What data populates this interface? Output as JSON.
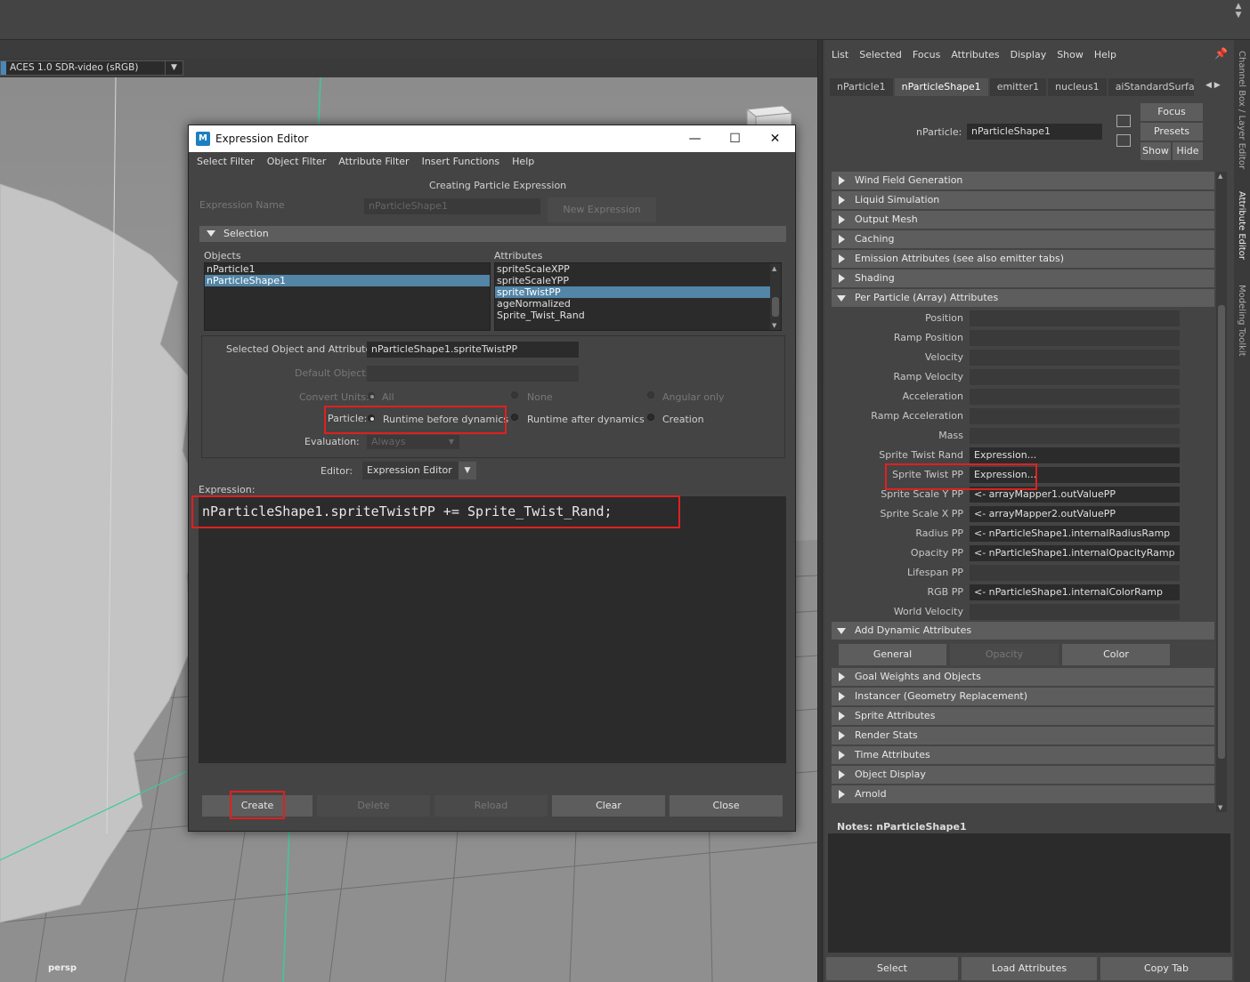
{
  "viewport": {
    "color_space": "ACES 1.0 SDR-video (sRGB)",
    "camera_label": "persp"
  },
  "expression_editor": {
    "title": "Expression Editor",
    "menu": [
      "Select Filter",
      "Object Filter",
      "Attribute Filter",
      "Insert Functions",
      "Help"
    ],
    "subtitle": "Creating Particle Expression",
    "expression_name_label": "Expression Name",
    "expression_name_value": "nParticleShape1",
    "new_expression_button": "New Expression",
    "selection_header": "Selection",
    "objects_label": "Objects",
    "attributes_label": "Attributes",
    "objects": [
      "nParticle1",
      "nParticleShape1"
    ],
    "attributes": [
      "spriteScaleXPP",
      "spriteScaleYPP",
      "spriteTwistPP",
      "ageNormalized",
      "Sprite_Twist_Rand"
    ],
    "selected_label": "Selected Object and Attribute:",
    "selected_value": "nParticleShape1.spriteTwistPP",
    "default_object_label": "Default Object:",
    "convert_units_label": "Convert Units:",
    "convert_units_options": [
      "All",
      "None",
      "Angular only"
    ],
    "particle_label": "Particle:",
    "particle_options": [
      "Runtime before dynamics",
      "Runtime after dynamics",
      "Creation"
    ],
    "evaluation_label": "Evaluation:",
    "evaluation_value": "Always",
    "editor_label": "Editor:",
    "editor_value": "Expression Editor",
    "expression_label": "Expression:",
    "expression_code": "nParticleShape1.spriteTwistPP += Sprite_Twist_Rand;",
    "buttons": {
      "create": "Create",
      "delete": "Delete",
      "reload": "Reload",
      "clear": "Clear",
      "close": "Close"
    }
  },
  "attribute_editor": {
    "menu": [
      "List",
      "Selected",
      "Focus",
      "Attributes",
      "Display",
      "Show",
      "Help"
    ],
    "tabs": [
      "nParticle1",
      "nParticleShape1",
      "emitter1",
      "nucleus1",
      "aiStandardSurface"
    ],
    "node_label": "nParticle:",
    "node_value": "nParticleShape1",
    "focus_button": "Focus",
    "presets_button": "Presets",
    "show_button": "Show",
    "hide_button": "Hide",
    "sections_top": [
      "Wind Field Generation",
      "Liquid Simulation",
      "Output Mesh",
      "Caching",
      "Emission Attributes (see also emitter tabs)",
      "Shading"
    ],
    "per_particle_header": "Per Particle (Array) Attributes",
    "per_particle_rows": [
      {
        "label": "Position",
        "value": ""
      },
      {
        "label": "Ramp Position",
        "value": ""
      },
      {
        "label": "Velocity",
        "value": ""
      },
      {
        "label": "Ramp Velocity",
        "value": ""
      },
      {
        "label": "Acceleration",
        "value": ""
      },
      {
        "label": "Ramp Acceleration",
        "value": ""
      },
      {
        "label": "Mass",
        "value": ""
      },
      {
        "label": "Sprite Twist Rand",
        "value": "Expression..."
      },
      {
        "label": "Sprite Twist PP",
        "value": "Expression..."
      },
      {
        "label": "Sprite Scale Y PP",
        "value": "<- arrayMapper1.outValuePP"
      },
      {
        "label": "Sprite Scale X PP",
        "value": "<- arrayMapper2.outValuePP"
      },
      {
        "label": "Radius PP",
        "value": "<- nParticleShape1.internalRadiusRamp"
      },
      {
        "label": "Opacity PP",
        "value": "<- nParticleShape1.internalOpacityRamp"
      },
      {
        "label": "Lifespan PP",
        "value": ""
      },
      {
        "label": "RGB PP",
        "value": "<- nParticleShape1.internalColorRamp"
      },
      {
        "label": "World Velocity",
        "value": ""
      }
    ],
    "add_dynamic_header": "Add Dynamic Attributes",
    "dynamic_buttons": [
      "General",
      "Opacity",
      "Color"
    ],
    "sections_bottom": [
      "Goal Weights and Objects",
      "Instancer (Geometry Replacement)",
      "Sprite Attributes",
      "Render Stats",
      "Time Attributes",
      "Object Display",
      "Arnold"
    ],
    "notes_label": "Notes:  nParticleShape1",
    "bottom_buttons": [
      "Select",
      "Load Attributes",
      "Copy Tab"
    ]
  },
  "side_tabs": [
    "Channel Box / Layer Editor",
    "Attribute Editor",
    "Modeling Toolkit"
  ],
  "colors": {
    "highlight": "#e02020",
    "selection": "#5285a6",
    "panel": "#444444",
    "field": "#2b2b2b"
  }
}
